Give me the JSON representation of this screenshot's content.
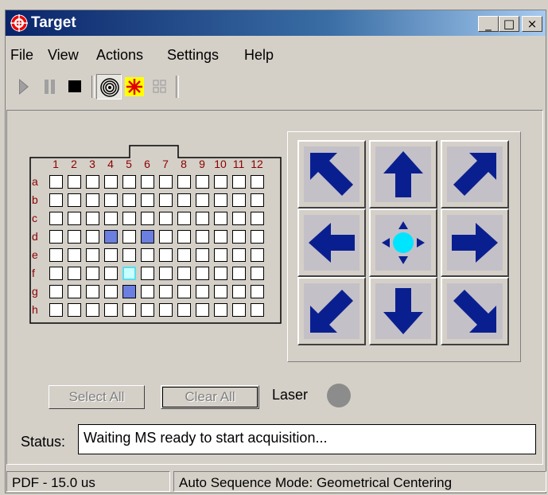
{
  "window": {
    "title": "Target"
  },
  "titlebar_buttons": {
    "minimize": "_",
    "maximize": "□",
    "close": "×"
  },
  "menu": [
    "File",
    "View",
    "Actions",
    "Settings",
    "Help"
  ],
  "toolbar": {
    "items": [
      {
        "name": "play-icon",
        "enabled": false
      },
      {
        "name": "pause-icon",
        "enabled": false
      },
      {
        "name": "stop-icon",
        "enabled": true
      },
      {
        "name": "spiral-target-icon",
        "pressed": true
      },
      {
        "name": "laser-star-icon",
        "pressed": false
      },
      {
        "name": "grid-icon",
        "enabled": false
      }
    ]
  },
  "plate": {
    "columns": [
      "1",
      "2",
      "3",
      "4",
      "5",
      "6",
      "7",
      "8",
      "9",
      "10",
      "11",
      "12"
    ],
    "rows": [
      "a",
      "b",
      "c",
      "d",
      "e",
      "f",
      "g",
      "h"
    ],
    "selected_wells": [
      "d4",
      "d6",
      "g5"
    ],
    "current_well": "f5",
    "colors": {
      "selected": "#6b7fe0",
      "current_fill": "#c8ffff",
      "current_border": "#58e0ea",
      "label": "#8b0000"
    }
  },
  "dirpad": {
    "buttons": [
      "up-left",
      "up",
      "up-right",
      "left",
      "center",
      "right",
      "down-left",
      "down",
      "down-right"
    ],
    "arrow_color": "#0a1f8f",
    "center_color": "#00e5ff"
  },
  "buttons": {
    "select_all": "Select All",
    "clear_all": "Clear All"
  },
  "laser": {
    "label": "Laser",
    "state_color": "#8c8c8c"
  },
  "status": {
    "label": "Status:",
    "value": "Waiting MS ready to start acquisition..."
  },
  "statusbar": {
    "pane1": "PDF - 15.0 us",
    "pane2": "Auto Sequence Mode: Geometrical Centering"
  }
}
